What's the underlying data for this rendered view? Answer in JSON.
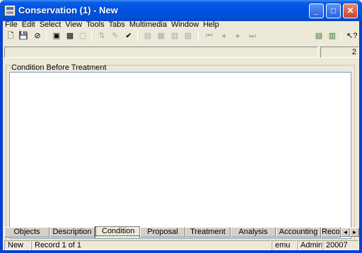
{
  "window": {
    "title": "Conservation (1) - New",
    "controls": {
      "minimize": "_",
      "maximize": "□",
      "close": "✕"
    }
  },
  "menu": [
    "File",
    "Edit",
    "Select",
    "View",
    "Tools",
    "Tabs",
    "Multimedia",
    "Window",
    "Help"
  ],
  "toolbar": {
    "icons": [
      "new-document-icon",
      "save-icon",
      "cancel-icon",
      "open-record-icon",
      "delete-record-icon",
      "copy-record-icon",
      "sort-icon",
      "edit-icon",
      "spell-check-icon",
      "view-list-icon",
      "view-grid-icon",
      "view-form-icon",
      "view-report-icon",
      "first-record-icon",
      "previous-record-icon",
      "next-record-icon",
      "last-record-icon",
      "export-icon",
      "import-icon",
      "context-help-icon"
    ]
  },
  "record_counter": "2",
  "group": {
    "label": "Condition Before Treatment",
    "value": ""
  },
  "tabs": {
    "items": [
      "Objects",
      "Description",
      "Condition",
      "Proposal",
      "Treatment",
      "Analysis",
      "Accounting",
      "Recor"
    ],
    "active": "Condition",
    "scroll_left": "◄",
    "scroll_right": "►"
  },
  "status": {
    "mode": "New",
    "record": "Record 1 of 1",
    "database": "emu",
    "user": "Admin",
    "version": "20007"
  }
}
